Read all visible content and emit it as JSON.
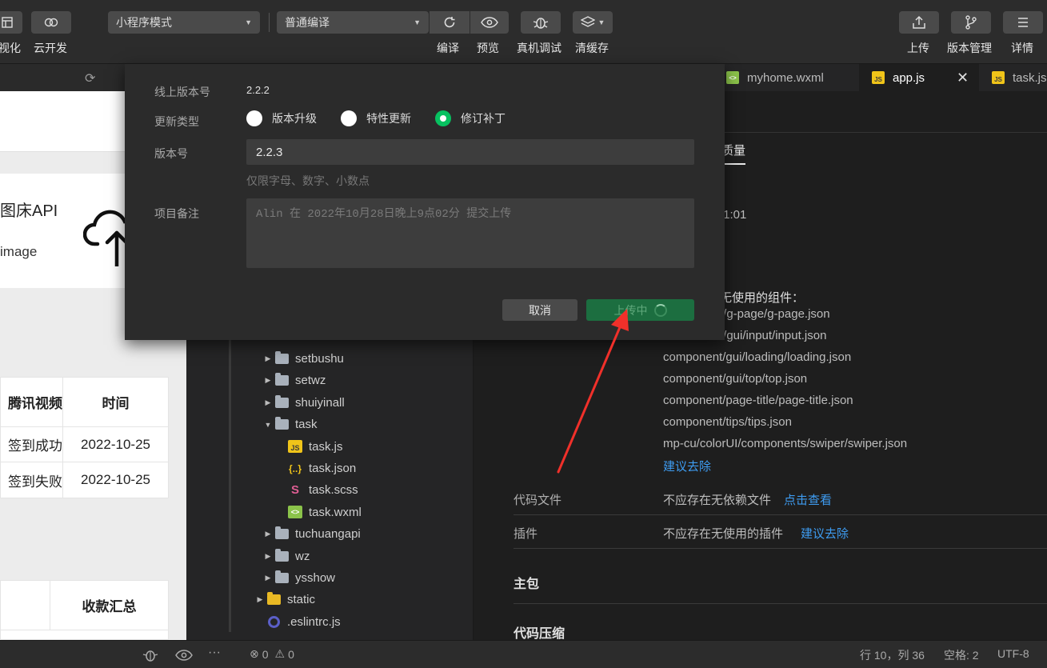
{
  "toolbar": {
    "left_buttons": [
      {
        "label": "视化",
        "icon": "visual-icon"
      },
      {
        "label": "云开发",
        "icon": "cloud-icon"
      }
    ],
    "mode_select": "小程序模式",
    "compile_select": "普通编译",
    "center_buttons": [
      {
        "label": "编译",
        "icon": "refresh-icon"
      },
      {
        "label": "预览",
        "icon": "eye-icon"
      },
      {
        "label": "真机调试",
        "icon": "bug-icon"
      },
      {
        "label": "清缓存",
        "icon": "layers-icon"
      }
    ],
    "right_buttons": [
      {
        "label": "上传",
        "icon": "upload-icon"
      },
      {
        "label": "版本管理",
        "icon": "branch-icon"
      },
      {
        "label": "详情",
        "icon": "menu-icon"
      }
    ]
  },
  "simulator": {
    "card_title": "图床API",
    "card_subtitle": "image",
    "table": {
      "headers": [
        "腾讯视频",
        "时间"
      ],
      "rows": [
        [
          "签到成功",
          "2022-10-25"
        ],
        [
          "签到失败",
          "2022-10-25"
        ]
      ]
    },
    "table2_header": "收款汇总"
  },
  "file_tree": [
    {
      "name": "setbushu",
      "type": "folder",
      "depth": 1,
      "expanded": false
    },
    {
      "name": "setwz",
      "type": "folder",
      "depth": 1,
      "expanded": false
    },
    {
      "name": "shuiyinall",
      "type": "folder",
      "depth": 1,
      "expanded": false
    },
    {
      "name": "task",
      "type": "folder",
      "depth": 1,
      "expanded": true
    },
    {
      "name": "task.js",
      "type": "js",
      "depth": 2
    },
    {
      "name": "task.json",
      "type": "json",
      "depth": 2
    },
    {
      "name": "task.scss",
      "type": "scss",
      "depth": 2
    },
    {
      "name": "task.wxml",
      "type": "wxml",
      "depth": 2
    },
    {
      "name": "tuchuangapi",
      "type": "folder",
      "depth": 1,
      "expanded": false
    },
    {
      "name": "wz",
      "type": "folder",
      "depth": 1,
      "expanded": false
    },
    {
      "name": "ysshow",
      "type": "folder",
      "depth": 1,
      "expanded": false
    },
    {
      "name": "static",
      "type": "folder-yellow",
      "depth": 0,
      "expanded": false
    },
    {
      "name": ".eslintrc.js",
      "type": "eslint",
      "depth": 0
    }
  ],
  "tabs": [
    {
      "label": "myhome.wxml",
      "type": "wxml",
      "active": false
    },
    {
      "label": "app.js",
      "type": "js",
      "active": true
    },
    {
      "label": "task.js",
      "type": "js",
      "active": false
    }
  ],
  "editor": {
    "subtab_label": "质量",
    "time_fragment": ":1:01",
    "unused_components_title": "无使用的组件：",
    "components": [
      "t/g-page/g-page.json",
      "t/gui/input/input.json",
      "component/gui/loading/loading.json",
      "component/gui/top/top.json",
      "component/page-title/page-title.json",
      "component/tips/tips.json",
      "mp-cu/colorUI/components/swiper/swiper.json"
    ],
    "suggest_remove": "建议去除",
    "code_files_label": "代码文件",
    "code_files_text": "不应存在无依赖文件",
    "code_files_link": "点击查看",
    "plugins_label": "插件",
    "plugins_text": "不应存在无使用的插件",
    "plugins_link": "建议去除",
    "main_package": "主包",
    "code_compress": "代码压缩"
  },
  "dialog": {
    "online_version_label": "线上版本号",
    "online_version_value": "2.2.2",
    "update_type_label": "更新类型",
    "update_types": [
      {
        "label": "版本升级",
        "selected": false
      },
      {
        "label": "特性更新",
        "selected": false
      },
      {
        "label": "修订补丁",
        "selected": true
      }
    ],
    "version_label": "版本号",
    "version_value": "2.2.3",
    "version_hint": "仅限字母、数字、小数点",
    "remark_label": "项目备注",
    "remark_placeholder": "Alin 在 2022年10月28日晚上9点02分 提交上传",
    "cancel_label": "取消",
    "upload_label": "上传中"
  },
  "status_bar": {
    "errors": "0",
    "warnings": "0",
    "position": "行 10，列 36",
    "indent": "空格: 2",
    "encoding": "UTF-8"
  },
  "colors": {
    "accent_green": "#07c160",
    "link_blue": "#3e9cf1",
    "annotation_red": "#f0302a"
  }
}
